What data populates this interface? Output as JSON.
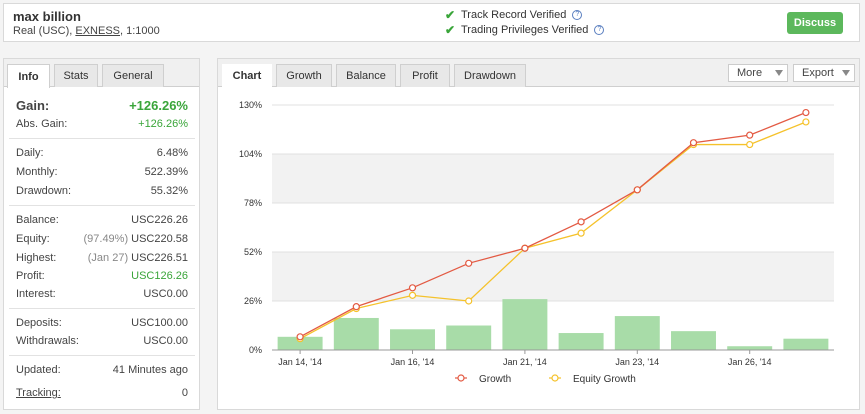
{
  "header": {
    "account_name": "max billion",
    "account_type": "Real (USC),",
    "broker": "EXNESS",
    "leverage": ", 1:1000",
    "verified_1": "Track Record Verified",
    "verified_2": "Trading Privileges Verified",
    "discuss_label": "Discuss",
    "check_color": "#3aa53a",
    "discuss_color": "#5cb85c"
  },
  "left_tabs": [
    "Info",
    "Stats",
    "General"
  ],
  "info": {
    "gain_label": "Gain:",
    "gain_value": "+126.26%",
    "abs_gain_label": "Abs. Gain:",
    "abs_gain_value": "+126.26%",
    "daily_label": "Daily:",
    "daily_value": "6.48%",
    "monthly_label": "Monthly:",
    "monthly_value": "522.39%",
    "drawdown_label": "Drawdown:",
    "drawdown_value": "55.32%",
    "balance_label": "Balance:",
    "balance_value": "USC226.26",
    "equity_label": "Equity:",
    "equity_pre": "(97.49%)",
    "equity_value": "USC220.58",
    "highest_label": "Highest:",
    "highest_pre": "(Jan 27)",
    "highest_value": "USC226.51",
    "profit_label": "Profit:",
    "profit_value": "USC126.26",
    "interest_label": "Interest:",
    "interest_value": "USC0.00",
    "deposits_label": "Deposits:",
    "deposits_value": "USC100.00",
    "withdrawals_label": "Withdrawals:",
    "withdrawals_value": "USC0.00",
    "updated_label": "Updated:",
    "updated_value": "41 Minutes ago",
    "tracking_label": "Tracking:",
    "tracking_value": "0"
  },
  "right_tabs": [
    "Chart",
    "Growth",
    "Balance",
    "Profit",
    "Drawdown"
  ],
  "more_label": "More",
  "export_label": "Export",
  "chart_data": {
    "type": "line",
    "y_ticks": [
      "130%",
      "104%",
      "78%",
      "52%",
      "26%",
      "0%"
    ],
    "ylim": [
      0,
      130
    ],
    "x_tick_labels": [
      {
        "label": "Jan 14, '14",
        "pos": 0.5
      },
      {
        "label": "Jan 16, '14",
        "pos": 2.5
      },
      {
        "label": "Jan 21, '14",
        "pos": 4.5
      },
      {
        "label": "Jan 23, '14",
        "pos": 6.5
      },
      {
        "label": "Jan 26, '14",
        "pos": 8.5
      }
    ],
    "bar_count": 10,
    "bars": [
      7,
      17,
      11,
      13,
      27,
      9,
      18,
      10,
      2,
      6
    ],
    "series": [
      {
        "name": "Growth",
        "color": "#e35a43",
        "points": [
          [
            0.5,
            7
          ],
          [
            1.5,
            23
          ],
          [
            2.5,
            33
          ],
          [
            3.5,
            46
          ],
          [
            4.5,
            54
          ],
          [
            5.5,
            68
          ],
          [
            6.5,
            85
          ],
          [
            7.5,
            110
          ],
          [
            8.5,
            114
          ],
          [
            9.5,
            126
          ]
        ]
      },
      {
        "name": "Equity Growth",
        "color": "#f5c22b",
        "points": [
          [
            0.5,
            6
          ],
          [
            1.5,
            22
          ],
          [
            2.5,
            29
          ],
          [
            3.5,
            26
          ],
          [
            4.5,
            54
          ],
          [
            5.5,
            62
          ],
          [
            6.5,
            85
          ],
          [
            7.5,
            109
          ],
          [
            8.5,
            109
          ],
          [
            9.5,
            121
          ]
        ]
      }
    ],
    "bar_color": "#a8dca8",
    "band_color": "#f2f2f2",
    "grid": true,
    "legend_position": "bottom"
  }
}
